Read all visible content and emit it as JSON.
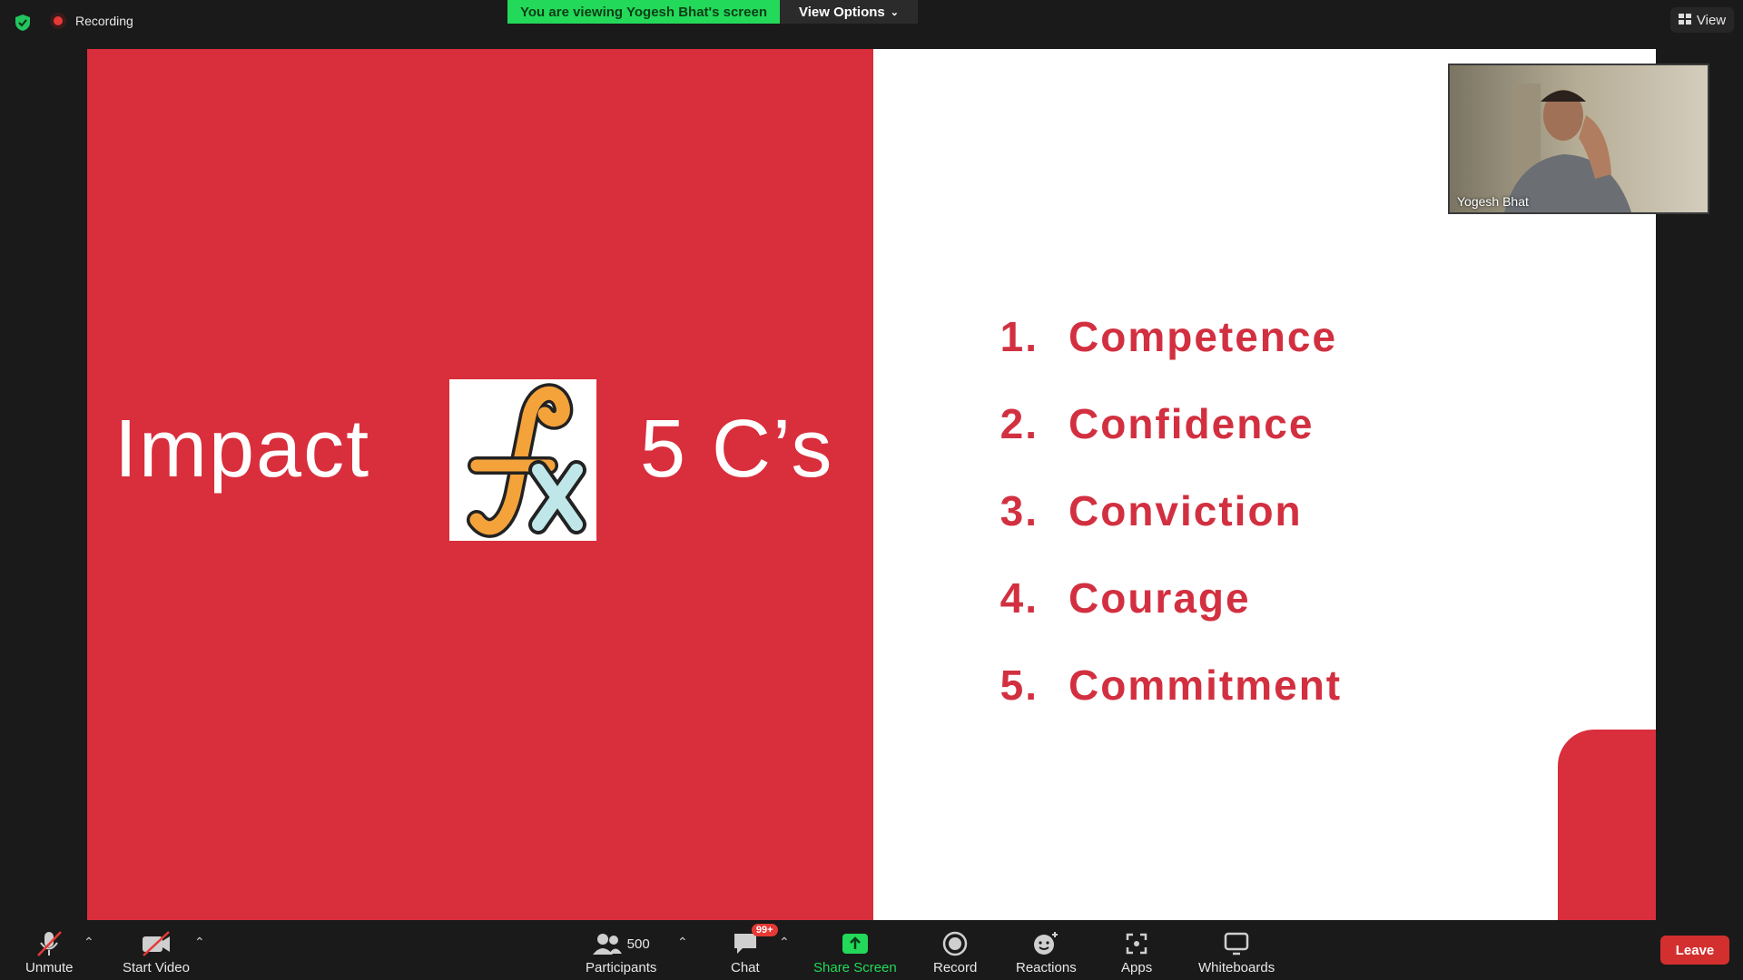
{
  "topbar": {
    "recording_label": "Recording",
    "viewing_banner": "You are viewing Yogesh Bhat's screen",
    "view_options_label": "View Options",
    "view_button_label": "View"
  },
  "slide": {
    "left_word": "Impact",
    "right_word": "5 C’s",
    "fx_symbol_icon": "fx-function-icon",
    "list": [
      {
        "num": "1.",
        "text": "Competence"
      },
      {
        "num": "2.",
        "text": "Confidence"
      },
      {
        "num": "3.",
        "text": "Conviction"
      },
      {
        "num": "4.",
        "text": "Courage"
      },
      {
        "num": "5.",
        "text": "Commitment"
      }
    ],
    "accent_color": "#d92e3c"
  },
  "video": {
    "participant_name": "Yogesh Bhat"
  },
  "toolbar": {
    "unmute_label": "Unmute",
    "start_video_label": "Start Video",
    "participants_label": "Participants",
    "participants_count": "500",
    "chat_label": "Chat",
    "chat_badge": "99+",
    "share_screen_label": "Share Screen",
    "record_label": "Record",
    "reactions_label": "Reactions",
    "apps_label": "Apps",
    "whiteboards_label": "Whiteboards",
    "leave_label": "Leave"
  }
}
